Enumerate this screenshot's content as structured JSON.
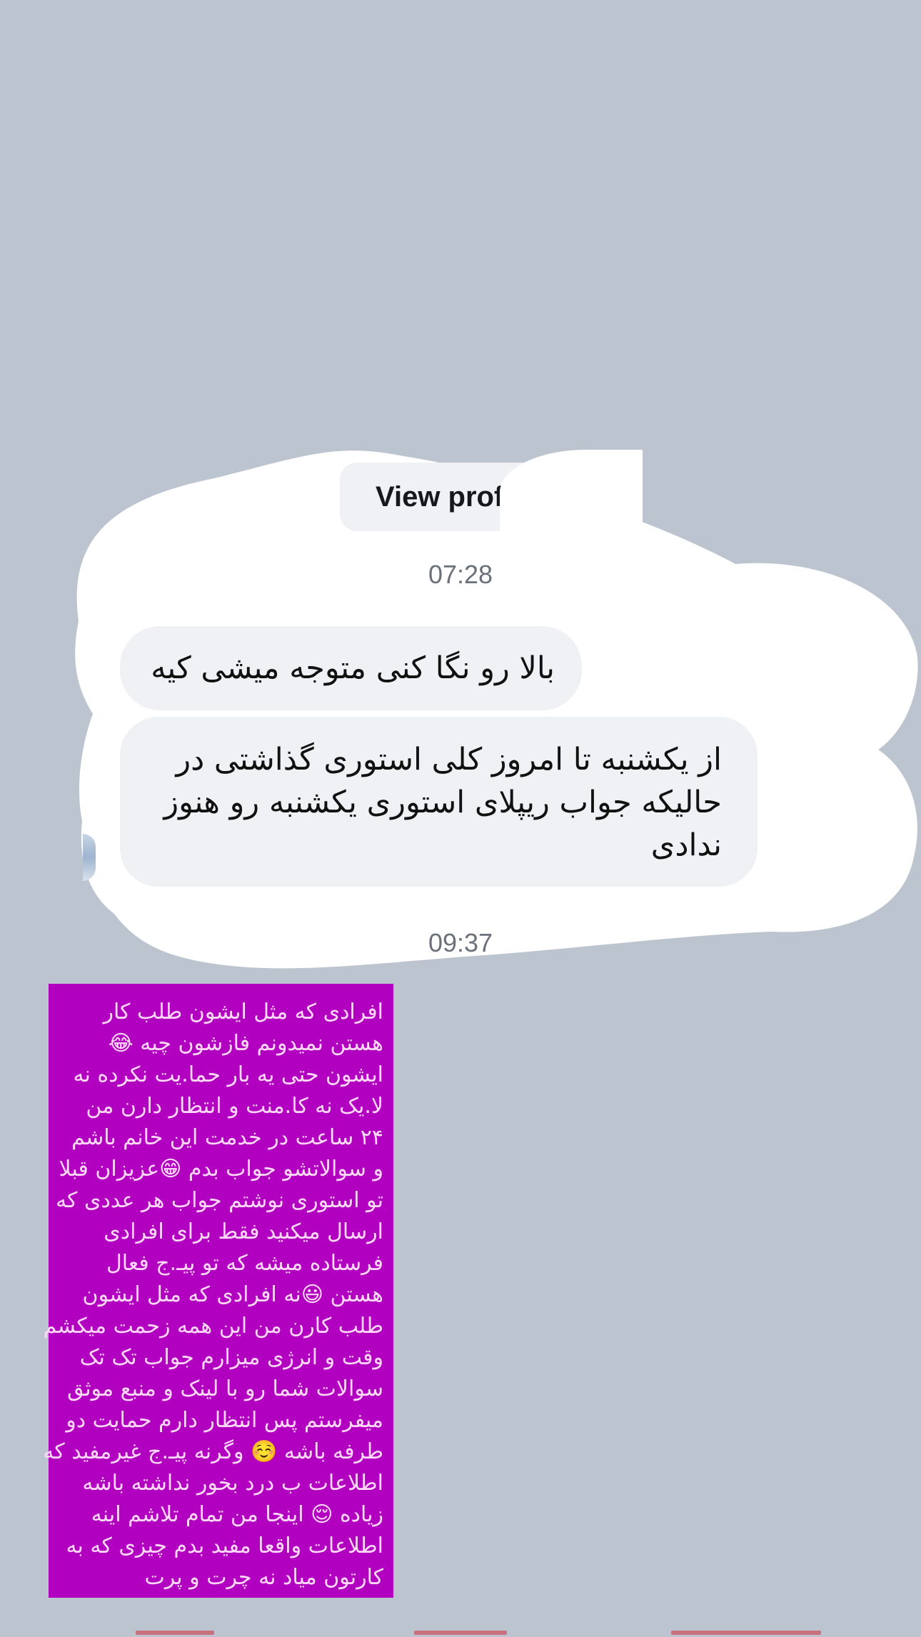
{
  "chat": {
    "view_profile_label": "View prof",
    "timestamp_1": "07:28",
    "timestamp_2": "09:37",
    "messages": [
      {
        "text": "بالا رو نگا کنی متوجه میشی کیه"
      },
      {
        "text": "از یکشنبه تا امروز  کلی استوری گذاشتی در حالیکه جواب ریپلای استوری یکشنبه رو هنوز ندادی"
      }
    ]
  },
  "shared_post": {
    "lines": [
      "افرادی که مثل ایشون طلب کار",
      "هستن نمیدونم فازشون چیه 😂",
      "ایشون حتی یه بار حما.یت نکرده نه",
      "لا.یک نه کا.منت و انتظار دارن من",
      "۲۴ ساعت در خدمت این خانم باشم",
      "و سوالاتشو جواب بدم 😁عزیزان قبلا",
      "تو استوری نوشتم جواب هر عددی که",
      "ارسال میکنید فقط برای افرادی",
      "فرستاده میشه که تو پیـ.ج فعال",
      "هستن 😃نه افرادی که مثل ایشون",
      "طلب کارن من این همه زحمت میکشم",
      "وقت و انرژی میزارم جواب تک تک",
      "سوالات شما رو با لینک و منبع موثق",
      "میفرستم پس انتظار دارم حمایت دو",
      "طرفه باشه ☺️ وگرنه پیـ.ج غیرمفید که",
      "اطلاعات ب درد بخور نداشته باشه",
      "زیاده 😌 اینجا من تمام تلاشم اینه",
      "اطلاعات واقعا مفید بدم چیزی که به",
      "کارتون میاد نه چرت و پرت"
    ]
  },
  "colors": {
    "background": "#bcc4cf",
    "bubble": "#eff1f4",
    "overlay": "#ffffff",
    "post_card": "#b100c0",
    "post_text": "#ffd9f7"
  }
}
